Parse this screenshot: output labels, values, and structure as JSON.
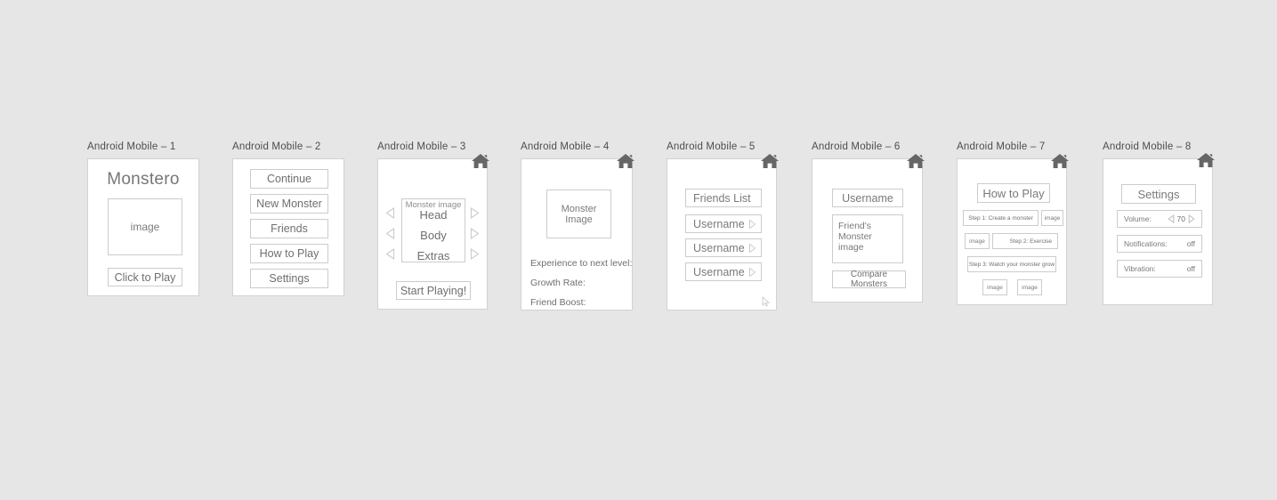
{
  "canvas": {
    "background": "#e6e6e6",
    "card_background": "#ffffff",
    "card_border": "#d2d2d2",
    "box_border": "#cccccc",
    "text_color": "#6f6f6f",
    "title_color": "#4d4d4d",
    "home_icon_color": "#666666"
  },
  "screens": [
    {
      "title": "Android Mobile – 1",
      "app_title": "Monstero",
      "image_placeholder": "image",
      "play_button": "Click to Play"
    },
    {
      "title": "Android Mobile – 2",
      "menu": [
        "Continue",
        "New Monster",
        "Friends",
        "How to Play",
        "Settings"
      ]
    },
    {
      "title": "Android Mobile – 3",
      "home_icon": "home-icon",
      "monster_image_label": "Monster image",
      "parts": [
        "Head",
        "Body",
        "Extras"
      ],
      "start_button": "Start Playing!"
    },
    {
      "title": "Android Mobile – 4",
      "home_icon": "home-icon",
      "monster_image_label": "Monster Image",
      "stats": [
        "Experience to next level:",
        "Growth Rate:",
        "Friend Boost:"
      ]
    },
    {
      "title": "Android Mobile – 5",
      "home_icon": "home-icon",
      "header": "Friends List",
      "friends": [
        "Username",
        "Username",
        "Username"
      ],
      "cursor": "mouse-cursor"
    },
    {
      "title": "Android Mobile – 6",
      "home_icon": "home-icon",
      "username": "Username",
      "friend_monster_image": "Friend's Monster image",
      "compare_button": "Compare Monsters"
    },
    {
      "title": "Android Mobile – 7",
      "home_icon": "home-icon",
      "header": "How to Play",
      "step1": "Step 1: Create a monster",
      "step2": "Step 2: Exercise",
      "step3": "Step 3: Watch your monster grow",
      "image_placeholder": "image"
    },
    {
      "title": "Android Mobile – 8",
      "home_icon": "home-icon",
      "header": "Settings",
      "settings": [
        {
          "label": "Volume:",
          "value": "70"
        },
        {
          "label": "Notifications:",
          "value": "off"
        },
        {
          "label": "Vibration:",
          "value": "off"
        }
      ]
    }
  ]
}
